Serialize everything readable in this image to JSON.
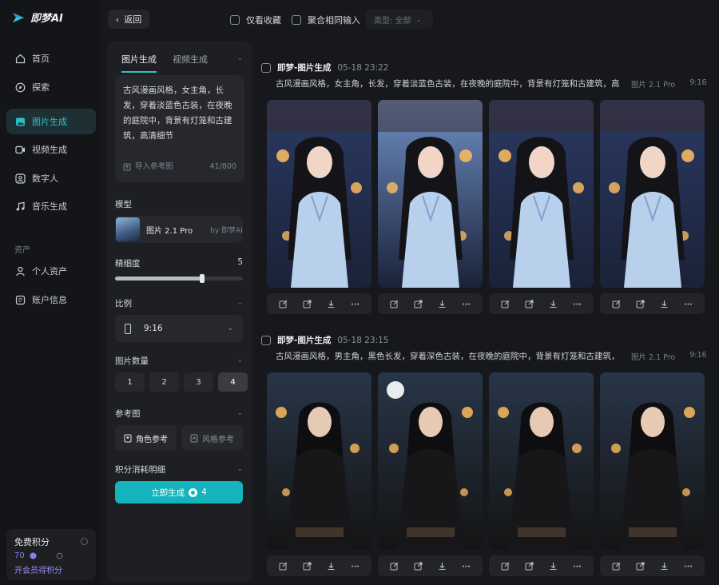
{
  "app": {
    "logo_text": "即梦AI"
  },
  "nav": {
    "items": [
      {
        "label": "首页",
        "icon": "home-icon"
      },
      {
        "label": "探索",
        "icon": "compass-icon"
      },
      {
        "label": "图片生成",
        "icon": "image-icon",
        "active": true
      },
      {
        "label": "视频生成",
        "icon": "video-icon"
      },
      {
        "label": "数字人",
        "icon": "avatar-icon"
      },
      {
        "label": "音乐生成",
        "icon": "music-icon"
      }
    ],
    "section_assets": "资产",
    "asset_items": [
      {
        "label": "个人资产",
        "icon": "user-icon"
      },
      {
        "label": "账户信息",
        "icon": "account-icon"
      }
    ],
    "credits": {
      "title": "免费积分",
      "value": "70",
      "link": "开会员得积分"
    }
  },
  "topbar": {
    "back_label": "返回",
    "only_favorites": "仅看收藏",
    "merge_inputs": "聚合相同输入",
    "type_select": "类型: 全部"
  },
  "panel": {
    "tabs": [
      "图片生成",
      "视频生成"
    ],
    "prompt": "古风漫画风格，女主角，长发，穿着淡蓝色古装，在夜晚的庭院中，背景有灯笼和古建筑，高清细节",
    "import_ref": "导入参考图",
    "char_count": "41/800",
    "model_label": "模型",
    "model_name": "图片 2.1 Pro",
    "model_by": "by 即梦AI",
    "detail_label": "精细度",
    "detail_value": "5",
    "detail_fraction": 0.68,
    "ratio_label": "比例",
    "ratio_value": "9:16",
    "count_label": "图片数量",
    "count_options": [
      "1",
      "2",
      "3",
      "4"
    ],
    "count_selected": "4",
    "ref_label": "参考图",
    "ref_character": "角色参考",
    "ref_style": "风格参考",
    "cost_label": "积分消耗明细",
    "generate_label": "立即生成",
    "generate_cost": "4"
  },
  "feed": {
    "groups": [
      {
        "title": "即梦-图片生成",
        "date": "05-18  23:22",
        "prompt": "古风漫画风格，女主角，长发，穿着淡蓝色古装，在夜晚的庭院中，背景有灯笼和古建筑，高清细节",
        "model": "图片 2.1 Pro",
        "ratio": "9:16"
      },
      {
        "title": "即梦-图片生成",
        "date": "05-18  23:15",
        "prompt": "古风漫画风格，男主角，黑色长发，穿着深色古装，在夜晚的庭院中，背景有灯笼和古建筑，高清细节",
        "model": "图片 2.1 Pro",
        "ratio": "9:16"
      }
    ]
  },
  "colors": {
    "accent": "#14b4bd",
    "nav_active_bg": "#1f3035",
    "credits_purple": "#9b8cf5"
  }
}
